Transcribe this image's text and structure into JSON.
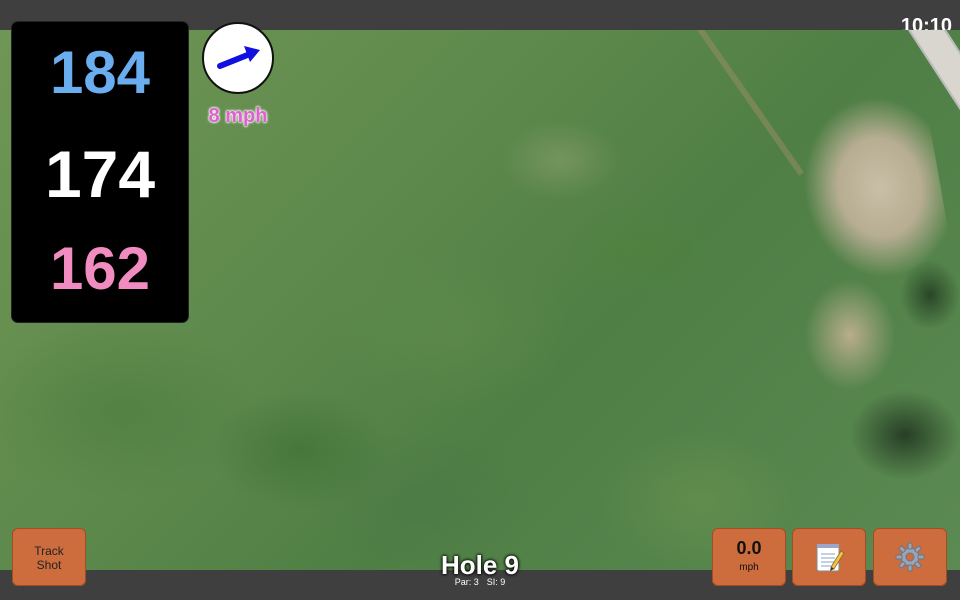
{
  "status_bar": {
    "time": "10:10"
  },
  "distances": {
    "back": "184",
    "center": "174",
    "front": "162"
  },
  "wind": {
    "speed_label": "8 mph",
    "arrow_icon": "wind-arrow-icon",
    "arrow_color": "#1010e0"
  },
  "buttons": {
    "track_shot": "Track\nShot",
    "speed_value": "0.0",
    "speed_unit": "mph",
    "notes_icon": "notepad-icon",
    "settings_icon": "gear-icon"
  },
  "hole": {
    "title": "Hole 9",
    "par": "Par: 3",
    "si": "SI: 9"
  },
  "colors": {
    "back": "#6aaef0",
    "center": "#ffffff",
    "front": "#f08cc0",
    "button": "#cd6d3d",
    "wind_text": "#e060d0"
  }
}
